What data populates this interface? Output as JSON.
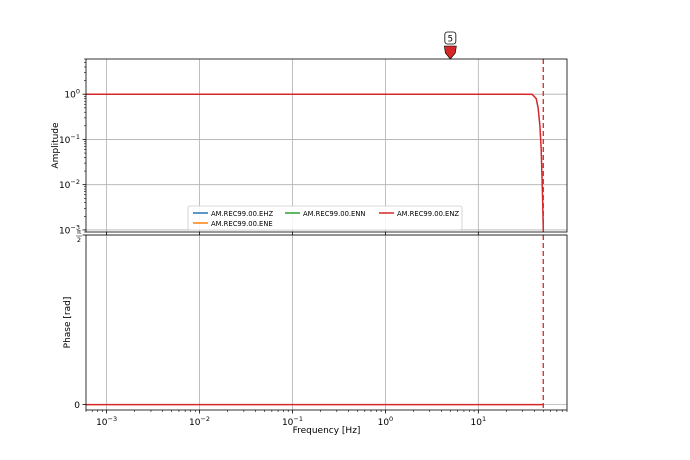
{
  "chart_data": [
    {
      "type": "line",
      "panel": "amplitude",
      "ylabel": "Amplitude",
      "xscale": "log",
      "yscale": "log",
      "xlim": [
        0.0006,
        90
      ],
      "ylim": [
        0.0009,
        6
      ],
      "grid": true,
      "x_ticks": [
        {
          "value": 0.001,
          "base": "10",
          "exp": "−3"
        },
        {
          "value": 0.01,
          "base": "10",
          "exp": "−2"
        },
        {
          "value": 0.1,
          "base": "10",
          "exp": "−1"
        },
        {
          "value": 1,
          "base": "10",
          "exp": "0"
        },
        {
          "value": 10,
          "base": "10",
          "exp": "1"
        }
      ],
      "y_ticks": [
        {
          "value": 1,
          "base": "10",
          "exp": "0"
        },
        {
          "value": 0.1,
          "base": "10",
          "exp": "−1"
        },
        {
          "value": 0.01,
          "base": "10",
          "exp": "−2"
        },
        {
          "value": 0.001,
          "base": "10",
          "exp": "−3"
        }
      ],
      "nyquist_line_x": 50,
      "marker": {
        "label": "5",
        "x": 5,
        "color": "#d62728"
      },
      "legend": {
        "placement": "lower-center",
        "entries": [
          {
            "name": "AM.REC99.00.EHZ",
            "color": "#1f77b4"
          },
          {
            "name": "AM.REC99.00.ENE",
            "color": "#ff7f0e"
          },
          {
            "name": "AM.REC99.00.ENN",
            "color": "#2ca02c"
          },
          {
            "name": "AM.REC99.00.ENZ",
            "color": "#d62728"
          }
        ]
      },
      "series": [
        {
          "name": "AM.REC99.00.ENZ",
          "color": "#d62728",
          "x": [
            0.0006,
            1,
            30,
            38,
            42,
            44,
            46,
            47.5,
            48.5,
            49.3,
            50
          ],
          "y": [
            1,
            1,
            1,
            0.99,
            0.8,
            0.5,
            0.2,
            0.06,
            0.015,
            0.004,
            0.001
          ]
        }
      ]
    },
    {
      "type": "line",
      "panel": "phase",
      "xlabel": "Frequency [Hz]",
      "ylabel": "Phase [rad]",
      "xscale": "log",
      "xlim": [
        0.0006,
        90
      ],
      "ylim": [
        -0.05,
        1.5708
      ],
      "grid": true,
      "y_ticks": [
        {
          "value": 0,
          "label": "0"
        },
        {
          "value": 1.5708,
          "num": "π",
          "den": "2"
        }
      ],
      "nyquist_line_x": 50,
      "series": [
        {
          "name": "AM.REC99.00.ENZ",
          "color": "#d62728",
          "x": [
            0.0006,
            50
          ],
          "y": [
            0,
            0
          ]
        }
      ]
    }
  ]
}
